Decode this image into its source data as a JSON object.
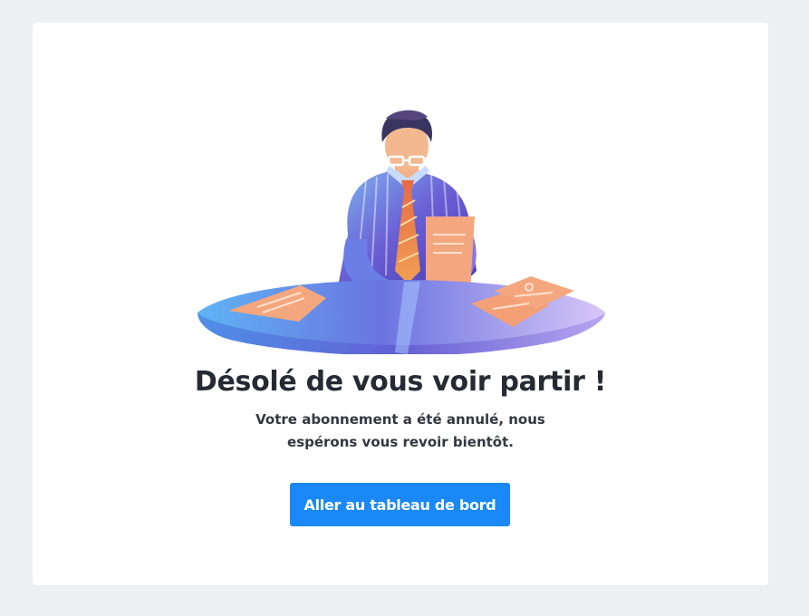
{
  "page": {
    "title": "Désolé de vous voir partir !",
    "message": "Votre abonnement a été annulé, nous espérons vous revoir bientôt.",
    "button_label": "Aller au tableau de bord"
  },
  "colors": {
    "background": "#eeeff2",
    "card": "#ffffff",
    "title": "#262a33",
    "button": "#1a88f6",
    "button_text": "#ffffff"
  },
  "illustration": {
    "icon": "businessman-reading-documents-icon"
  }
}
